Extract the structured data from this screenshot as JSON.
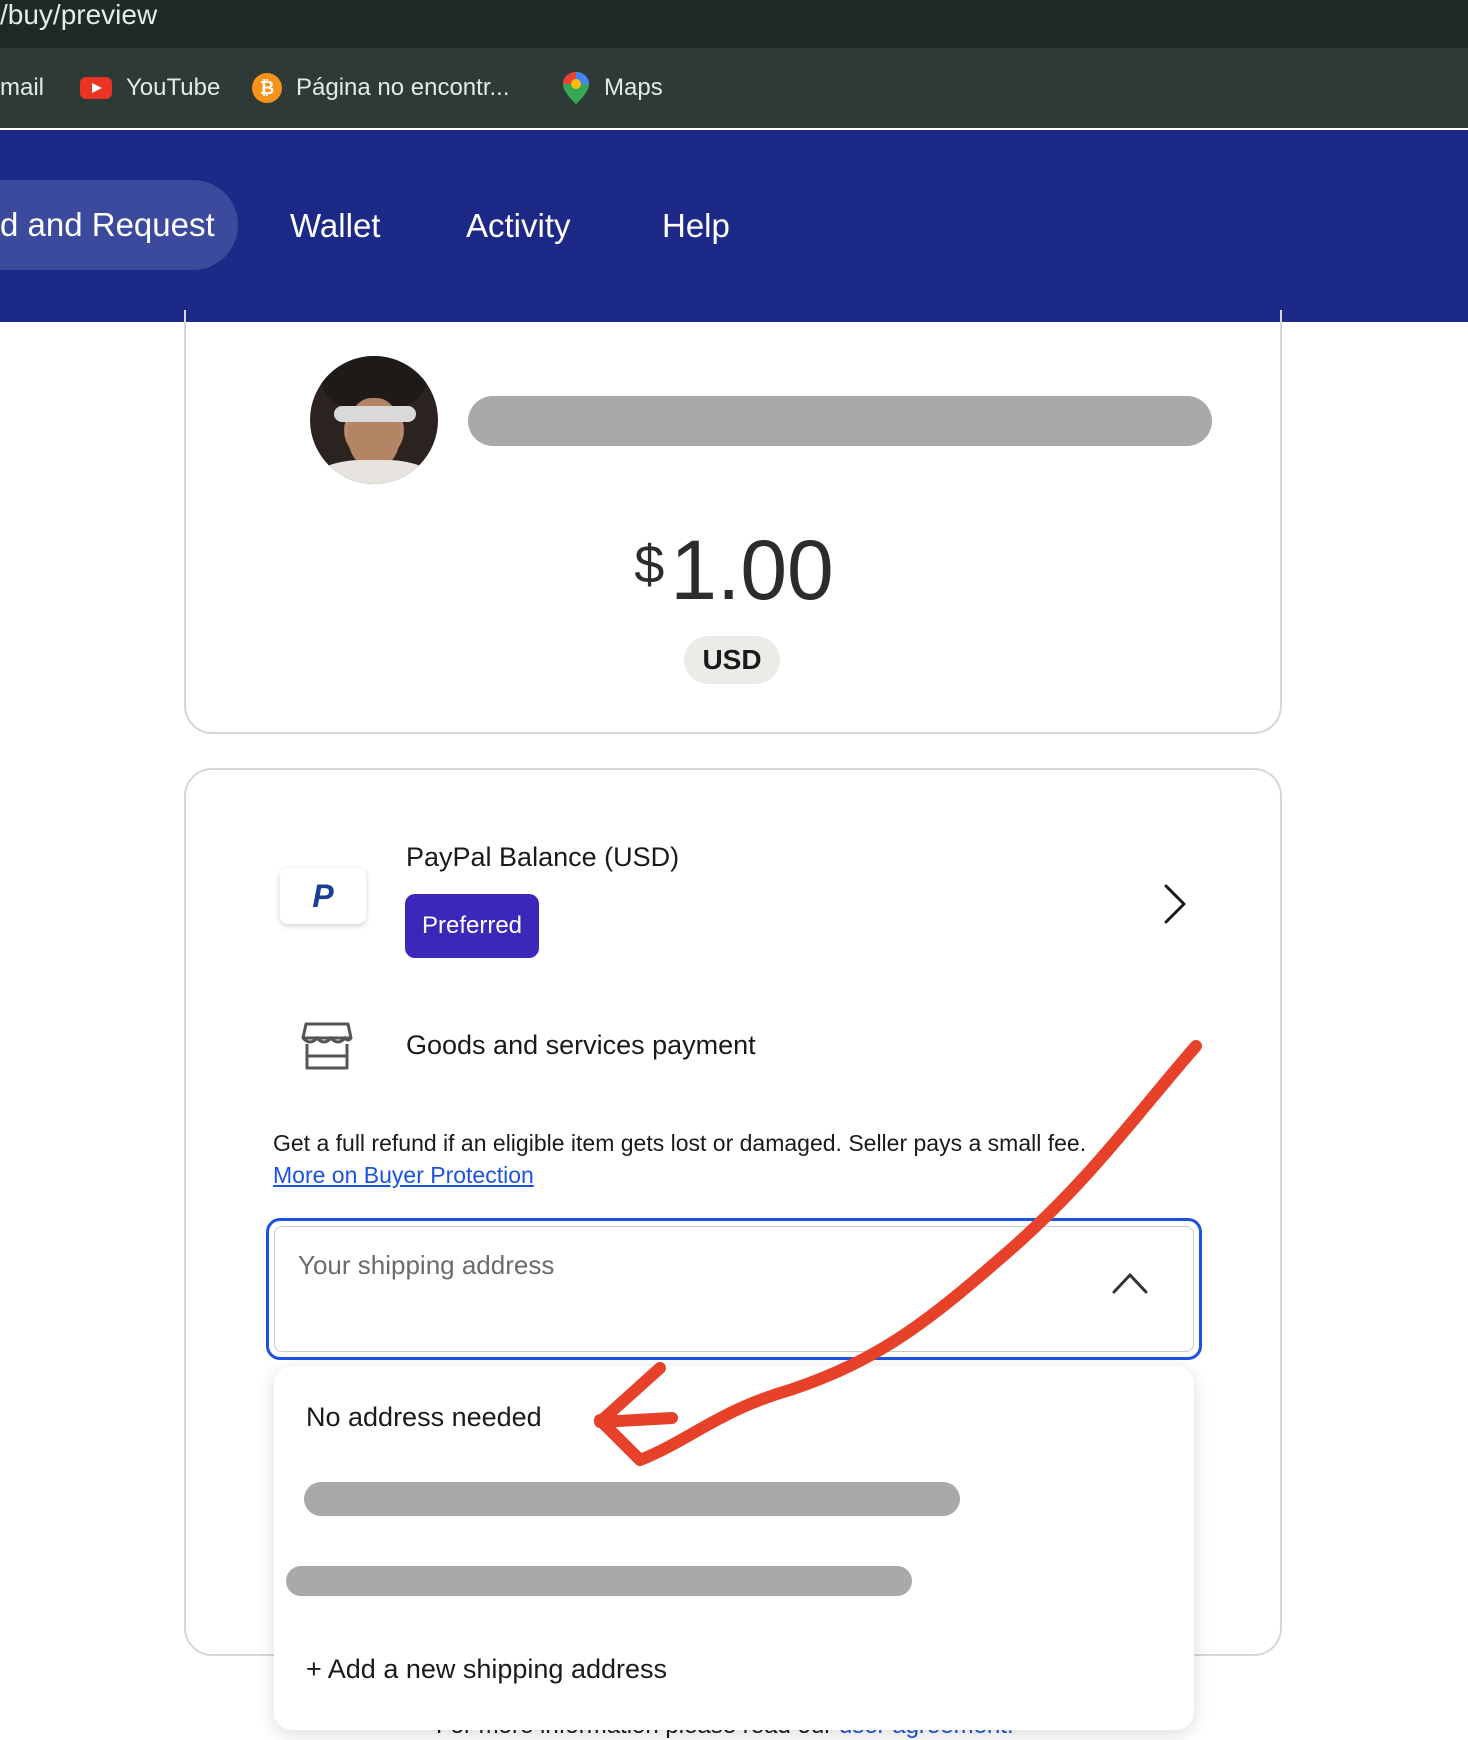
{
  "browser": {
    "url_fragment": "/buy/preview",
    "bookmarks": [
      {
        "label": "mail",
        "icon": "gmail-icon"
      },
      {
        "label": "YouTube",
        "icon": "youtube-icon"
      },
      {
        "label": "Página no encontr...",
        "icon": "bitcoin-icon"
      },
      {
        "label": "Maps",
        "icon": "maps-pin-icon"
      }
    ]
  },
  "nav": {
    "tabs": [
      "d and Request",
      "Wallet",
      "Activity",
      "Help"
    ],
    "active_tab": "d and Request",
    "color": "#1d2987"
  },
  "payment": {
    "currency_symbol": "$",
    "amount": "1.00",
    "currency_code": "USD"
  },
  "method": {
    "title": "PayPal Balance (USD)",
    "badge": "Preferred",
    "badge_color": "#3b28b8",
    "type": "Goods and services payment",
    "refund_text": "Get a full refund if an eligible item gets lost or damaged. Seller pays a small fee.",
    "protection_link": "More on Buyer Protection"
  },
  "shipping": {
    "placeholder": "Your shipping address",
    "options": [
      "No address needed",
      "+ Add a new shipping address"
    ]
  },
  "footer": {
    "text": "For more information please read our",
    "link": "user agreement."
  },
  "annotation_color": "#e8412a"
}
